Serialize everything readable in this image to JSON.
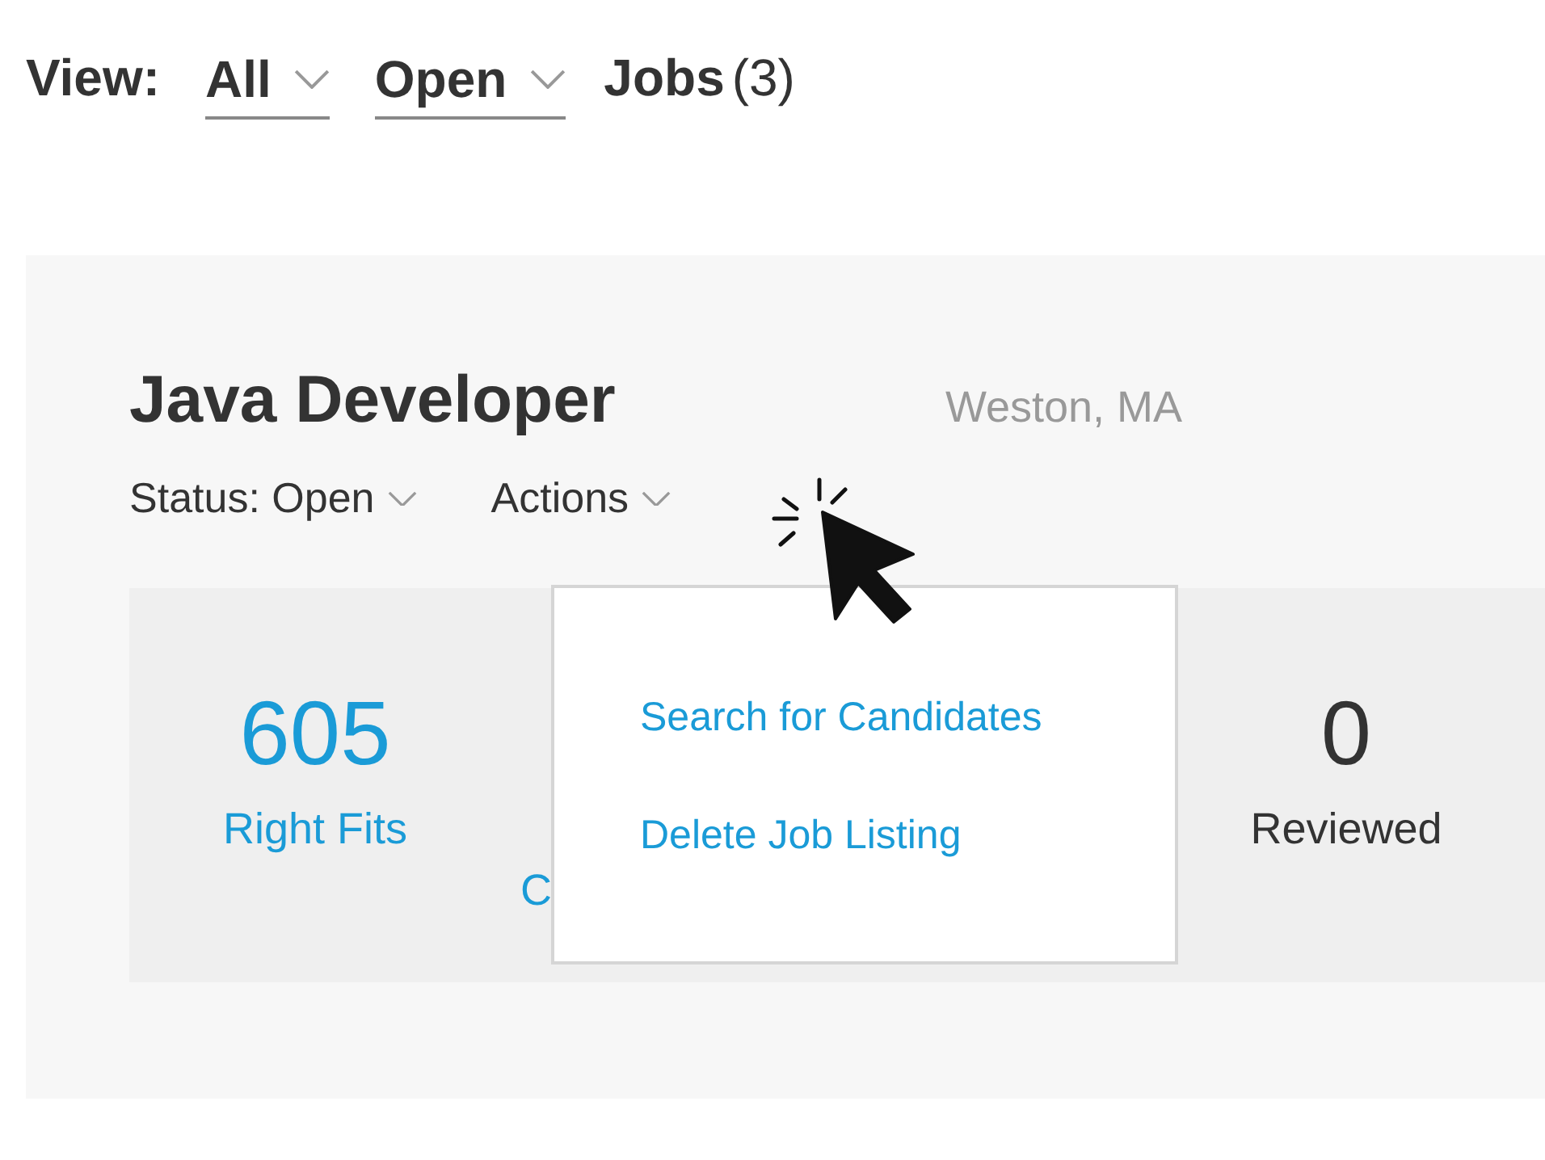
{
  "view_bar": {
    "label": "View:",
    "filters": [
      {
        "value": "All"
      },
      {
        "value": "Open"
      }
    ],
    "jobs_label": "Jobs",
    "jobs_count": "(3)"
  },
  "job": {
    "title": "Java Developer",
    "location": "Weston, MA",
    "status": "Status: Open",
    "actions": "Actions",
    "stats": [
      {
        "kind": "link",
        "number": "605",
        "label": "Right Fits"
      },
      {
        "kind": "partial",
        "label": "C"
      },
      {
        "kind": "plain",
        "number": "0",
        "label": "Reviewed"
      }
    ]
  },
  "actions_menu": {
    "items": [
      {
        "label": "Search for Candidates"
      },
      {
        "label": "Delete Job Listing"
      }
    ]
  }
}
